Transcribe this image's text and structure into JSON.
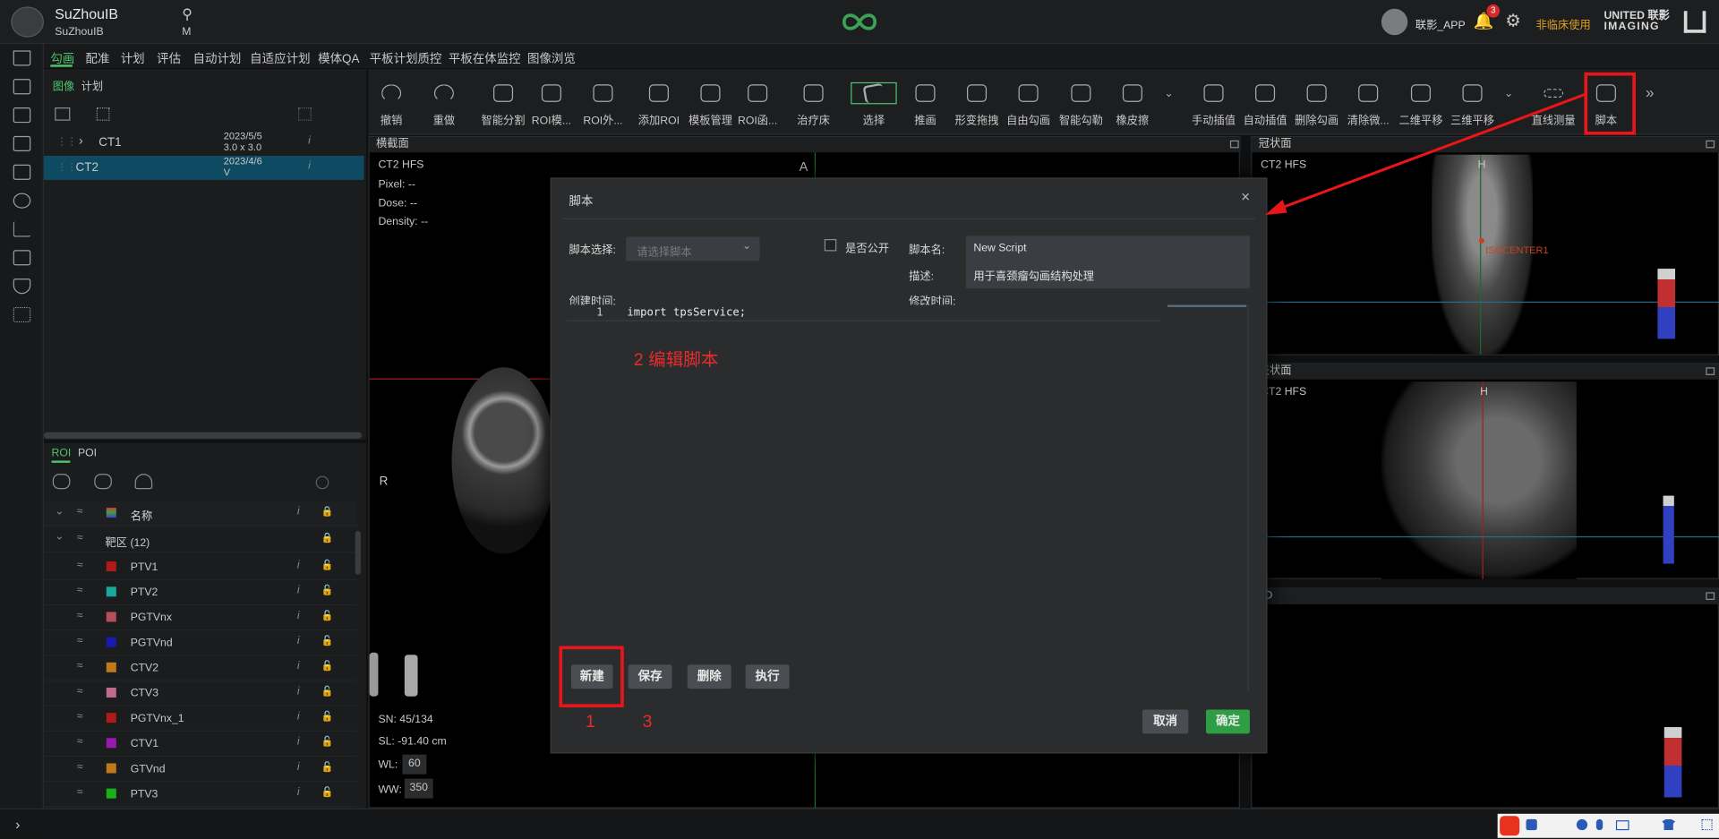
{
  "topbar": {
    "username": "SuZhouIB",
    "username_sub": "SuZhouIB",
    "patient_initial": "M",
    "app_user": "联影_APP",
    "notif_count": "3",
    "nonclinical": "非临床使用",
    "brand_line1": "UNITED 联影",
    "brand_line2": "IMAGING"
  },
  "menu": [
    "勾画",
    "配准",
    "计划",
    "评估",
    "自动计划",
    "自适应计划",
    "模体QA",
    "平板计划质控",
    "平板在体监控",
    "图像浏览"
  ],
  "left": {
    "tabs": [
      "图像",
      "计划"
    ],
    "images": [
      {
        "name": "CT1",
        "date": "2023/5/5",
        "meta": "3.0 x 3.0"
      },
      {
        "name": "CT2",
        "date": "2023/4/6",
        "meta": "V"
      }
    ],
    "roi_tabs": [
      "ROI",
      "POI"
    ],
    "roi_header": "名称",
    "roi_group": "靶区 (12)",
    "rois": [
      {
        "name": "PTV1",
        "color": "#b01a1a"
      },
      {
        "name": "PTV2",
        "color": "#1aa79b"
      },
      {
        "name": "PGTVnx",
        "color": "#b5505a"
      },
      {
        "name": "PGTVnd",
        "color": "#1a1ab0"
      },
      {
        "name": "CTV2",
        "color": "#c07a1a"
      },
      {
        "name": "CTV3",
        "color": "#c06a8a"
      },
      {
        "name": "PGTVnx_1",
        "color": "#b01a1a"
      },
      {
        "name": "CTV1",
        "color": "#9a1ab0"
      },
      {
        "name": "GTVnd",
        "color": "#c07a1a"
      },
      {
        "name": "PTV3",
        "color": "#1ab01a"
      }
    ]
  },
  "tools": [
    "撤销",
    "重做",
    "智能分割",
    "ROI模...",
    "ROI外...",
    "添加ROI",
    "模板管理",
    "ROI函...",
    "治疗床",
    "选择",
    "推画",
    "形变拖拽",
    "自由勾画",
    "智能勾勒",
    "橡皮擦",
    "手动插值",
    "自动插值",
    "删除勾画",
    "清除微...",
    "二维平移",
    "三维平移",
    "直线测量",
    "脚本"
  ],
  "viewports": {
    "axial": {
      "title": "横截面",
      "series": "CT2 HFS",
      "pixel": "Pixel:  --",
      "dose": "Dose:  --",
      "density": "Density:  --",
      "orient_top": "A",
      "orient_left": "R",
      "sn": "SN: 45/134",
      "sl": "SL: -91.40 cm",
      "wl_label": "WL:",
      "wl": "60",
      "ww_label": "WW:",
      "ww": "350"
    },
    "coronal": {
      "title": "冠状面",
      "series": "CT2 HFS",
      "orient": "H",
      "iso": "ISOCENTER1"
    },
    "sagittal": {
      "title": "矢状面",
      "series": "CT2 HFS",
      "orient": "H"
    },
    "threed": {
      "title": "3D"
    }
  },
  "dialog": {
    "title": "脚本",
    "script_select_label": "脚本选择:",
    "script_select_placeholder": "请选择脚本",
    "public_label": "是否公开",
    "name_label": "脚本名:",
    "name_value": "New Script",
    "desc_label": "描述:",
    "desc_value": "用于喜颈瘤勾画结构处理",
    "created_label": "创建时间:",
    "modified_label": "修改时间:",
    "line_no": "1",
    "code": "import tpsService;",
    "btn_new": "新建",
    "btn_save": "保存",
    "btn_delete": "删除",
    "btn_run": "执行",
    "btn_cancel": "取消",
    "btn_ok": "确定"
  },
  "annotations": {
    "step2": "2 编辑脚本",
    "step1": "1",
    "step3": "3"
  },
  "colors": {
    "accent": "#4fc36b",
    "highlight": "#e8161b",
    "ok": "#2e9e45",
    "selected_row": "#0e4b63"
  }
}
